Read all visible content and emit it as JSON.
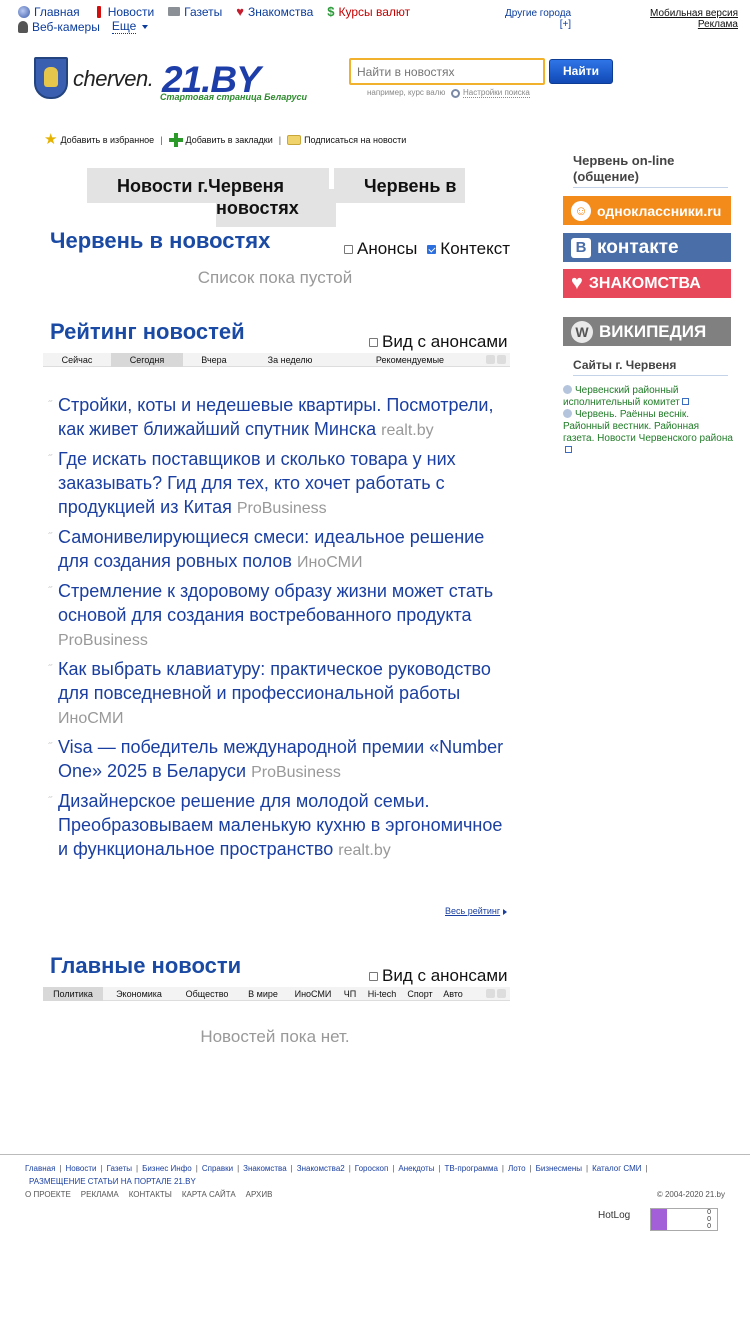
{
  "topnav": {
    "row1": [
      {
        "label": "Главная",
        "icon": "globe-icon"
      },
      {
        "label": "Новости",
        "icon": "news-icon"
      },
      {
        "label": "Газеты",
        "icon": "newspaper-icon"
      },
      {
        "label": "Знакомства",
        "icon": "heart-icon"
      },
      {
        "label": "Курсы валют",
        "icon": "dollar-icon"
      }
    ],
    "webcams": "Веб-камеры",
    "more": "Еще"
  },
  "other_cities": {
    "label": "Другие города",
    "plus": "[+]"
  },
  "right_links": {
    "mobile": "Мобильная версия",
    "ads": "Реклама"
  },
  "logo": {
    "city": "cherven.",
    "brand": "21.BY",
    "slogan": "Стартовая страница Беларуси"
  },
  "search": {
    "placeholder": "Найти в новостях",
    "button": "Найти",
    "hint": "например, курс валю",
    "settings": "Настройки поиска"
  },
  "actions": {
    "favorites": "Добавить в избранное",
    "bookmarks": "Добавить в закладки",
    "subscribe": "Подписаться на новости"
  },
  "tabs": {
    "tab1_line1": "Новости г.Червеня",
    "tab1_line2": "новостях",
    "tab2": "Червень в"
  },
  "cherven_news": {
    "title": "Червень в новостях",
    "anons": "Анонсы",
    "context": "Контекст",
    "empty": "Список пока пустой"
  },
  "rating": {
    "title": "Рейтинг новостей",
    "with_anons": "Вид с анонсами",
    "tabs": [
      "Сейчас",
      "Сегодня",
      "Вчера",
      "За неделю",
      "Рекомендуемые"
    ],
    "selected_tab": "Сегодня",
    "items": [
      {
        "title": "Стройки, коты и недешевые квартиры. Посмотрели, как живет ближайший спутник Минска",
        "source": "realt.by"
      },
      {
        "title": "Где искать поставщиков и сколько товара у них заказывать? Гид для тех, кто хочет работать с продукцией из Китая",
        "source": "ProBusiness"
      },
      {
        "title": "Самонивелирующиеся смеси: идеальное решение для создания ровных полов",
        "source": "ИноСМИ"
      },
      {
        "title": "Стремление к здоровому образу жизни может стать основой для создания востребованного продукта",
        "source": "ProBusiness"
      },
      {
        "title": "Как выбрать клавиатуру: практическое руководство для повседневной и профессиональной работы",
        "source": "ИноСМИ"
      },
      {
        "title": "Visa — победитель международной премии «Number One» 2025 в Беларуси",
        "source": "ProBusiness"
      },
      {
        "title": "Дизайнерское решение для молодой семьи. Преобразовываем маленькую кухню в эргономичное и функциональное пространство",
        "source": "realt.by"
      }
    ],
    "all": "Весь рейтинг"
  },
  "main_news": {
    "title": "Главные новости",
    "with_anons": "Вид с анонсами",
    "tabs": [
      "Политика",
      "Экономика",
      "Общество",
      "В мире",
      "ИноСМИ",
      "ЧП",
      "Hi-tech",
      "Спорт",
      "Авто"
    ],
    "selected_tab": "Политика",
    "empty": "Новостей пока нет."
  },
  "right": {
    "online_title": "Червень on-line (общение)",
    "ok": "одноклассники.ru",
    "vk": "контакте",
    "vk_letter": "B",
    "znak": "ЗНАКОМСТВА",
    "wiki": "ВИКИПЕДИЯ",
    "wiki_letter": "W",
    "sites_title": "Сайты г. Червеня",
    "sites": [
      "Червенский районный исполнительный комитет",
      "Червень. Раённы веснік. Районный вестник. Районная газета. Новости Червенского района"
    ]
  },
  "footer": {
    "links": [
      "Главная",
      "Новости",
      "Газеты",
      "Бизнес Инфо",
      "Справки",
      "Знакомства",
      "Знакомства2",
      "Гороскоп",
      "Анекдоты",
      "ТВ-программа",
      "Лото",
      "Бизнесмены",
      "Каталог СМИ"
    ],
    "placement": "РАЗМЕЩЕНИЕ СТАТЬИ НА ПОРТАЛЕ 21.BY",
    "bottom": [
      "О ПРОЕКТЕ",
      "РЕКЛАМА",
      "КОНТАКТЫ",
      "КАРТА САЙТА",
      "АРХИВ"
    ],
    "copyright": "© 2004-2020 21.by",
    "hotlog": "HotLog",
    "counter": [
      "0",
      "0",
      "0"
    ]
  },
  "colors": {
    "link": "#0b3c9c",
    "heading": "#1a4aa3",
    "ok": "#f28b19",
    "vk": "#4a6ea8",
    "znak": "#e8495a",
    "wiki": "#808080"
  }
}
